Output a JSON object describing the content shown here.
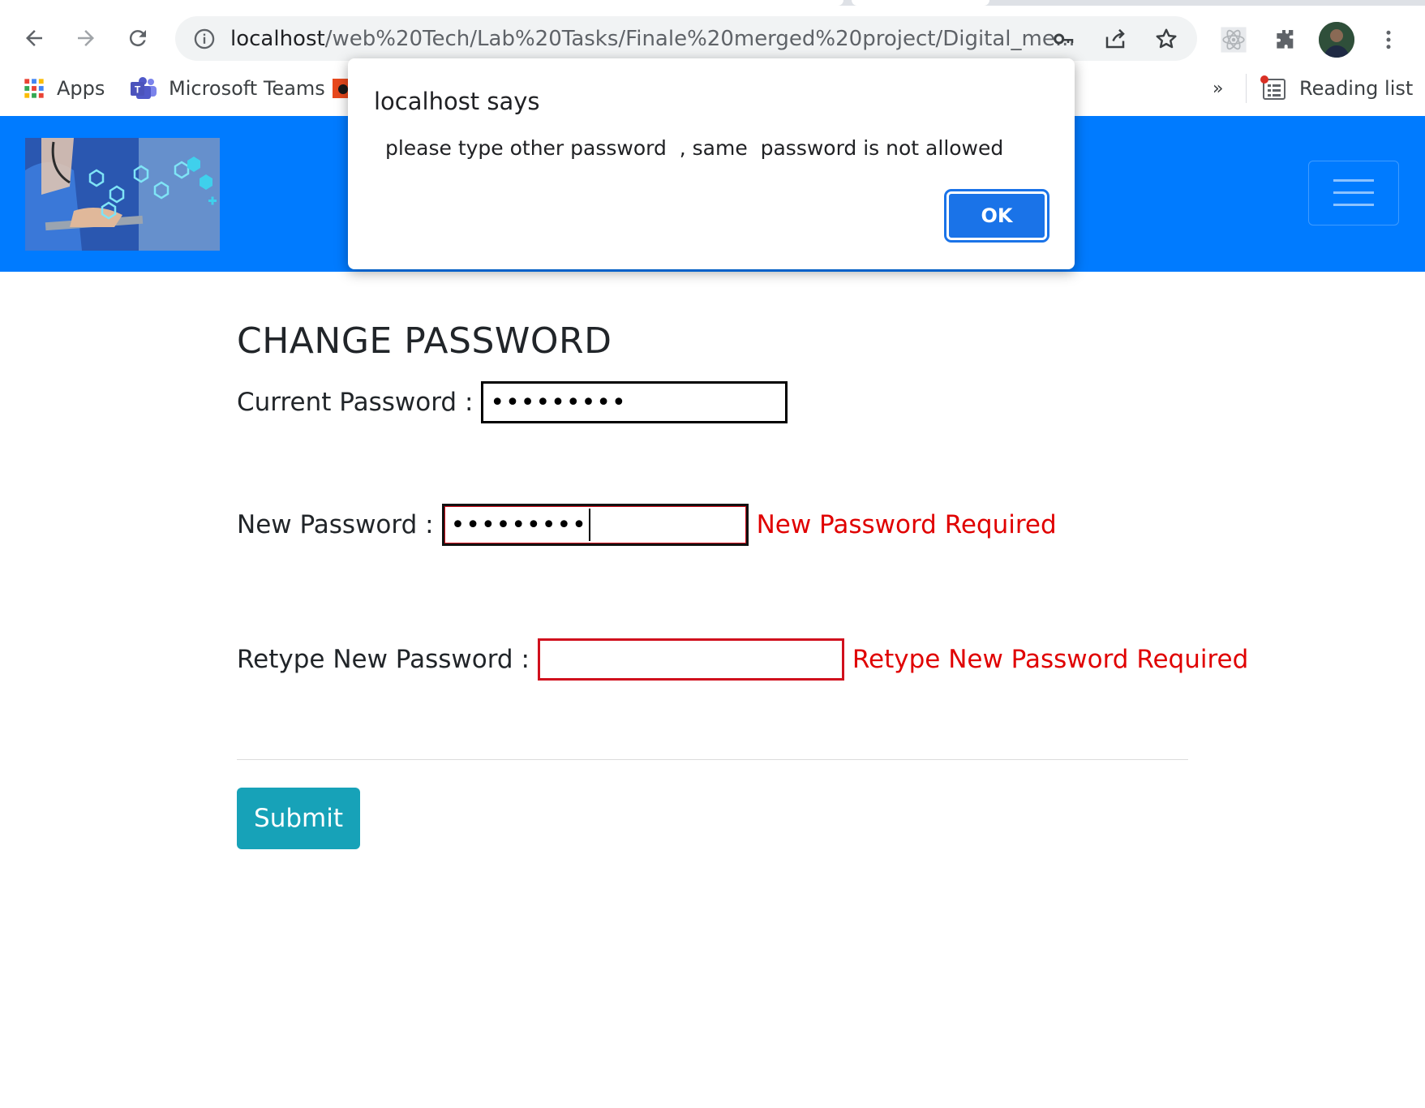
{
  "browser": {
    "url_host": "localhost",
    "url_path": "/web%20Tech/Lab%20Tasks/Finale%20merged%20project/Digital_me...",
    "bookmarks": [
      {
        "label": "Apps",
        "icon": "apps-grid-icon"
      },
      {
        "label": "Microsoft Teams",
        "icon": "teams-icon"
      }
    ],
    "overflow_label": "»",
    "reading_list_label": "Reading list"
  },
  "dialog": {
    "title": "localhost says",
    "message": " please type other password  , same  password is not allowed",
    "ok_label": "OK"
  },
  "page": {
    "title": "CHANGE PASSWORD",
    "current_password": {
      "label": "Current Password :",
      "value": "•••••••••"
    },
    "new_password": {
      "label": "New Password :",
      "value": "•••••••••",
      "error": "New Password Required"
    },
    "retype_password": {
      "label": "Retype New Password :",
      "value": "",
      "error": "Retype New Password Required"
    },
    "submit_label": "Submit"
  },
  "colors": {
    "navbar": "#007bff",
    "error": "#e00000",
    "submit": "#17a2b8",
    "dialog_button": "#1a73e8"
  }
}
